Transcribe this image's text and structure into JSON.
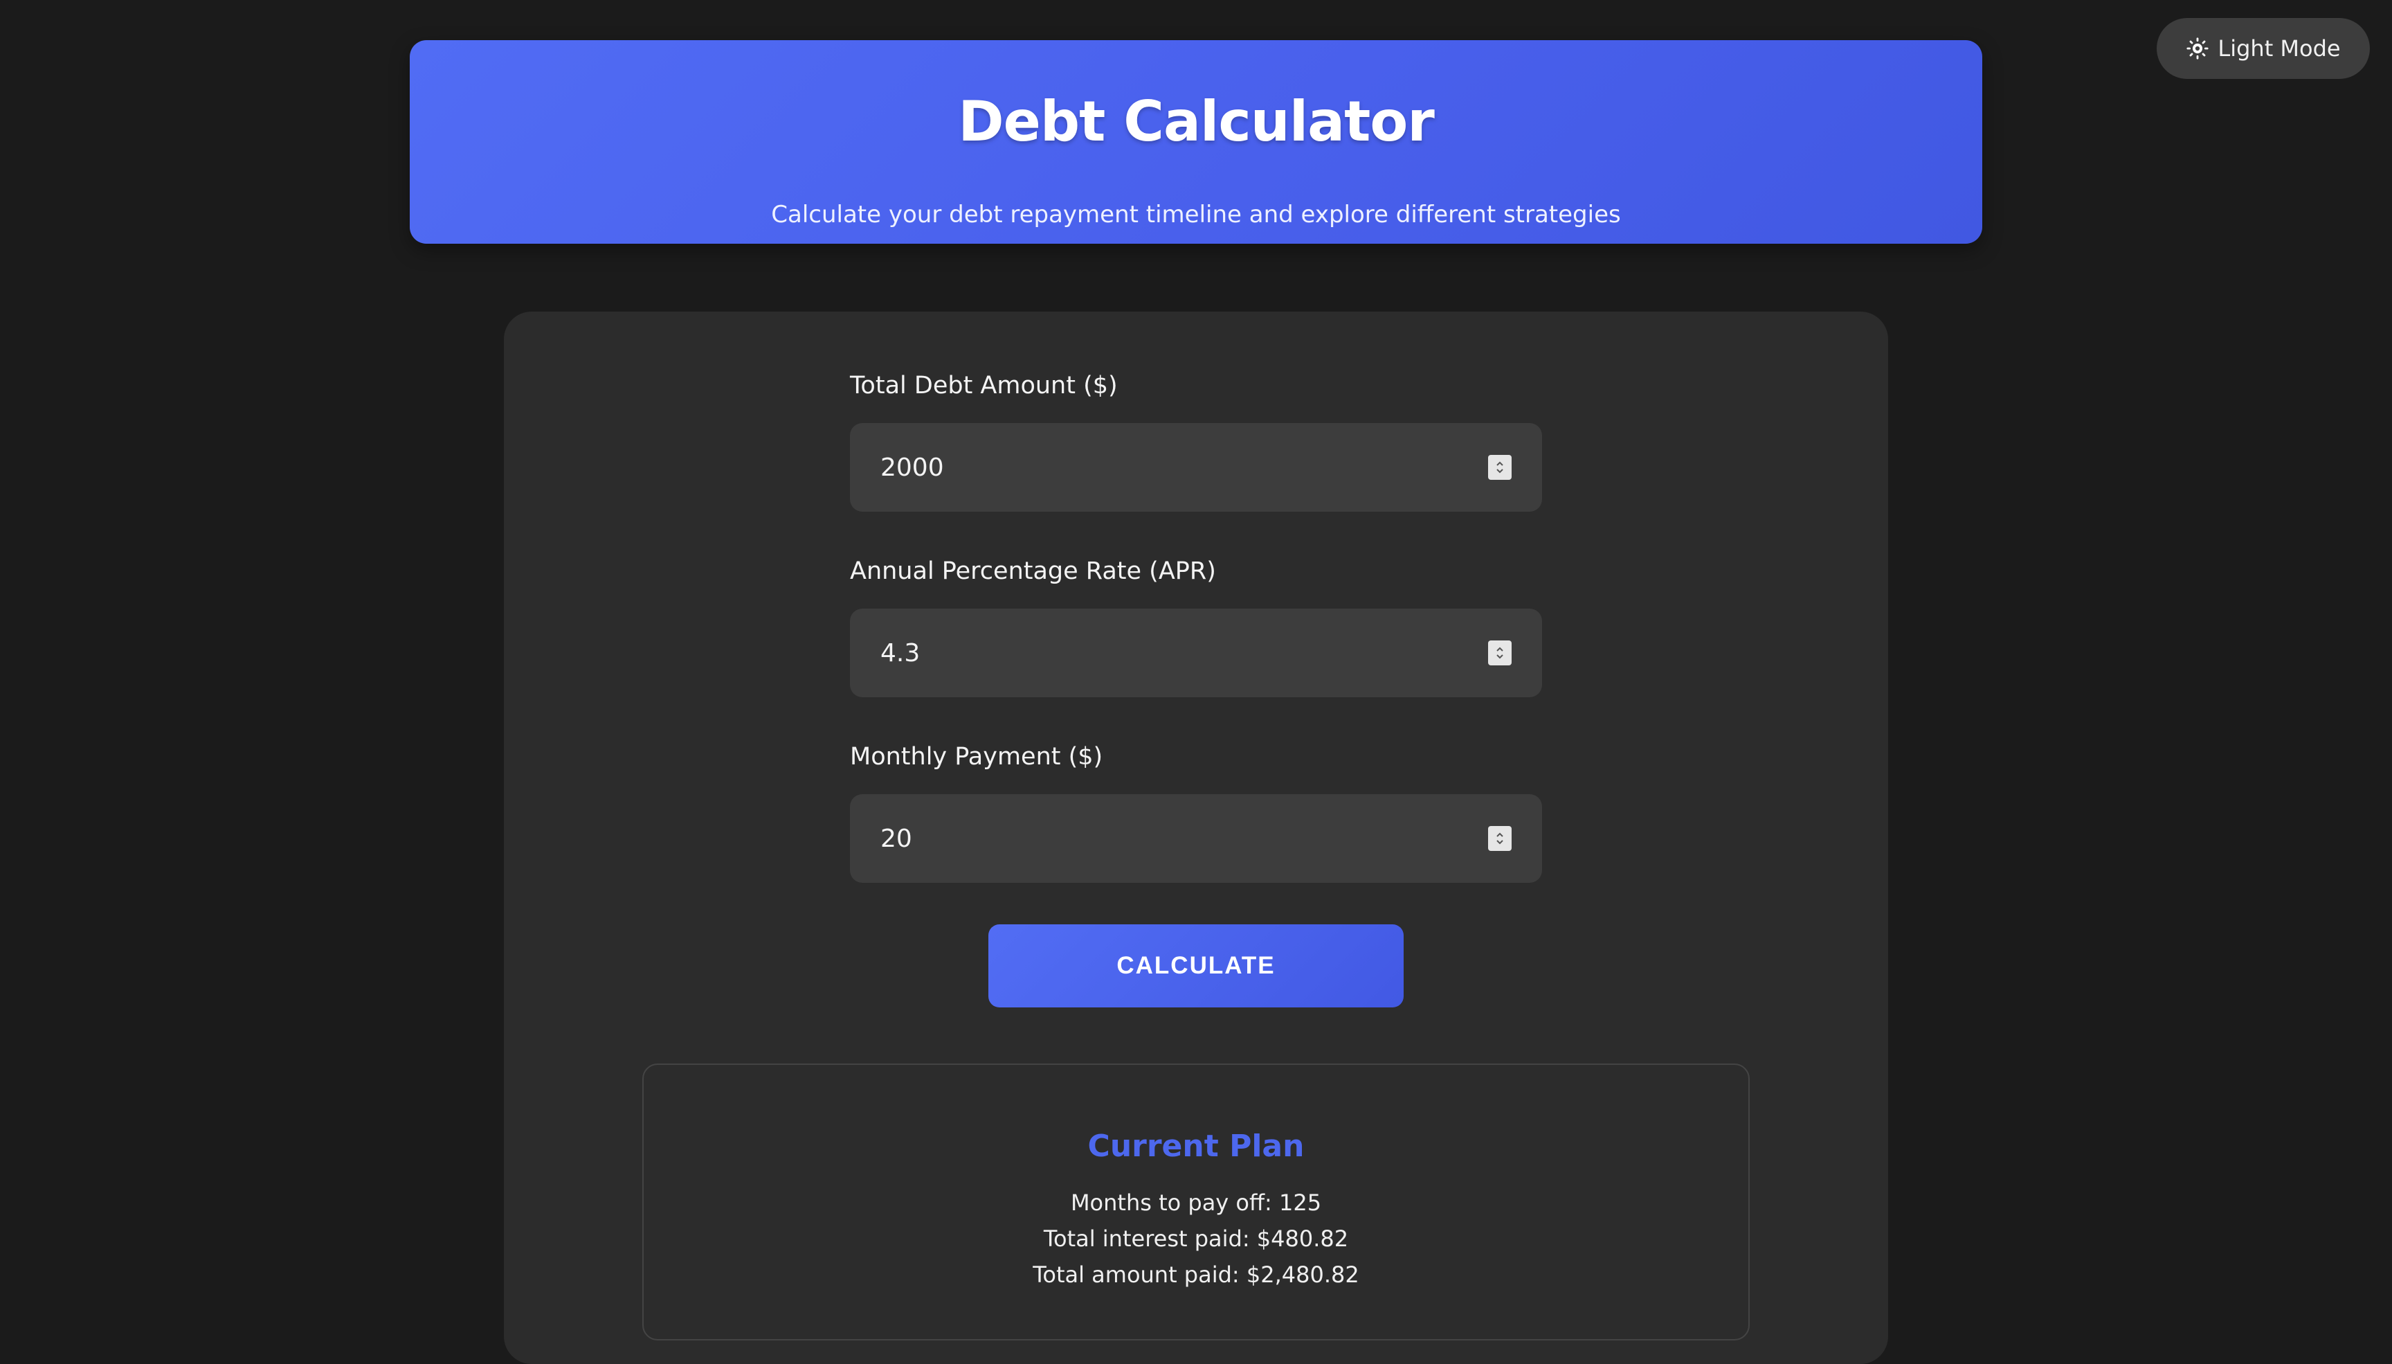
{
  "theme_toggle": {
    "label": "Light Mode",
    "icon": "sun-icon"
  },
  "header": {
    "title": "Debt Calculator",
    "subtitle": "Calculate your debt repayment timeline and explore different strategies"
  },
  "form": {
    "fields": [
      {
        "label": "Total Debt Amount ($)",
        "value": "2000"
      },
      {
        "label": "Annual Percentage Rate (APR)",
        "value": "4.3"
      },
      {
        "label": "Monthly Payment ($)",
        "value": "20"
      }
    ],
    "submit_label": "CALCULATE"
  },
  "results": {
    "title": "Current Plan",
    "lines": [
      "Months to pay off: 125",
      "Total interest paid: $480.82",
      "Total amount paid: $2,480.82"
    ]
  },
  "colors": {
    "background": "#1b1b1b",
    "card": "#2c2c2c",
    "input": "#3d3d3d",
    "accent": "#4d68ee"
  }
}
